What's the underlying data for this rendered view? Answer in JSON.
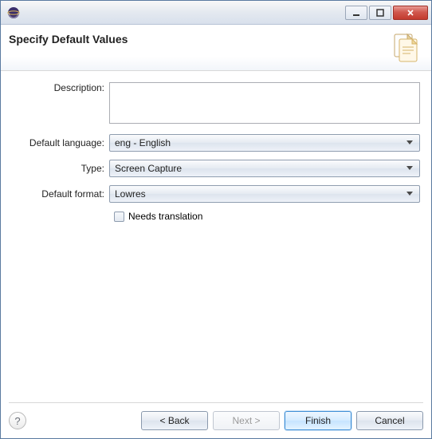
{
  "titlebar": {
    "title": ""
  },
  "header": {
    "title": "Specify Default Values"
  },
  "form": {
    "description_label": "Description:",
    "description_value": "",
    "default_language_label": "Default language:",
    "default_language_value": "eng - English",
    "type_label": "Type:",
    "type_value": "Screen Capture",
    "default_format_label": "Default format:",
    "default_format_value": "Lowres",
    "needs_translation_label": "Needs translation",
    "needs_translation_checked": false
  },
  "buttons": {
    "back": "< Back",
    "next": "Next >",
    "finish": "Finish",
    "cancel": "Cancel"
  }
}
